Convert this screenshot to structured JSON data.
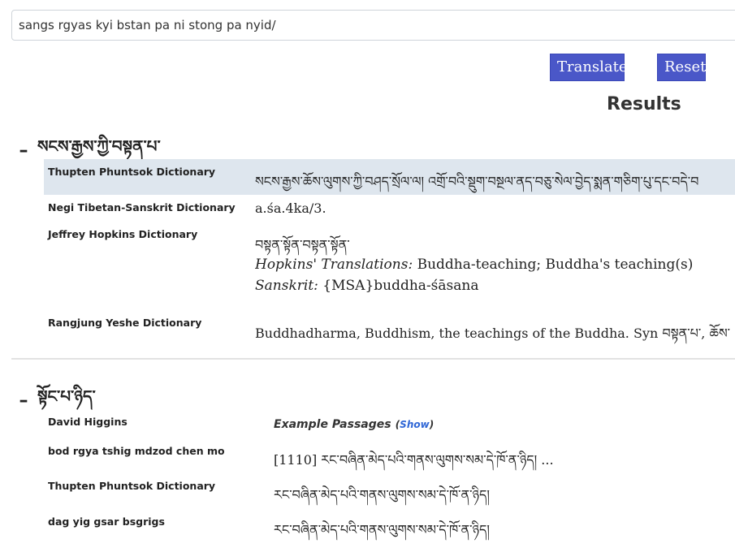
{
  "search": {
    "value": "sangs rgyas kyi bstan pa ni stong pa nyid/",
    "placeholder": ""
  },
  "buttons": {
    "translate": "Translate",
    "reset": "Reset"
  },
  "results_title": "Results",
  "sections": [
    {
      "toggle_symbol": "–",
      "heading": "སངས་རྒྱས་ཀྱི་བསྟན་པ་",
      "entries": [
        {
          "dictionary": "Thupten Phuntsok Dictionary",
          "text": "སངས་རྒྱས་ཆོས་ལུགས་ཀྱི་བཤད་སྲོལ་ལ། འགྲོ་བའི་སྡུག་བསྔལ་ནད་བཅུ་སེལ་བྱེད་སྨན་གཅིག་པུ་དང་བདེ་བ"
        },
        {
          "dictionary": "Negi Tibetan-Sanskrit Dictionary",
          "text": "a.śa.4ka/3."
        },
        {
          "dictionary": "Jeffrey Hopkins Dictionary",
          "tibetan": "བསྟན་སྟོན་བསྟན་སྟོན་",
          "translations_label": "Hopkins' Translations:",
          "translations_value": "Buddha-teaching; Buddha's teaching(s)",
          "sanskrit_label": "Sanskrit:",
          "sanskrit_value": "{MSA}buddha-śāsana"
        },
        {
          "dictionary": "Rangjung Yeshe Dictionary",
          "text": "Buddhadharma, Buddhism, the teachings of the Buddha. Syn བསྟན་པ་, ཆོས་"
        }
      ]
    },
    {
      "toggle_symbol": "–",
      "heading": "སྟོང་པ་ཉིད་",
      "entries": [
        {
          "dictionary": "David Higgins",
          "example_label": "Example Passages",
          "paren_open": "(",
          "show_label": "Show",
          "paren_close": ")"
        },
        {
          "dictionary": "bod rgya tshig mdzod chen mo",
          "text": "[1110] རང་བཞིན་མེད་པའི་གནས་ལུགས་སམ་དེ་ཁོ་ན་ཉིད། ..."
        },
        {
          "dictionary": "Thupten Phuntsok Dictionary",
          "text": "རང་བཞིན་མེད་པའི་གནས་ལུགས་སམ་དེ་ཁོ་ན་ཉིད།"
        },
        {
          "dictionary": "dag yig gsar bsgrigs",
          "text": "རང་བཞིན་མེད་པའི་གནས་ལུགས་སམ་དེ་ཁོ་ན་ཉིད།"
        }
      ]
    }
  ],
  "colors": {
    "button": "#4a57c8",
    "highlight_row": "#dee6ee",
    "link": "#2f66d6"
  }
}
